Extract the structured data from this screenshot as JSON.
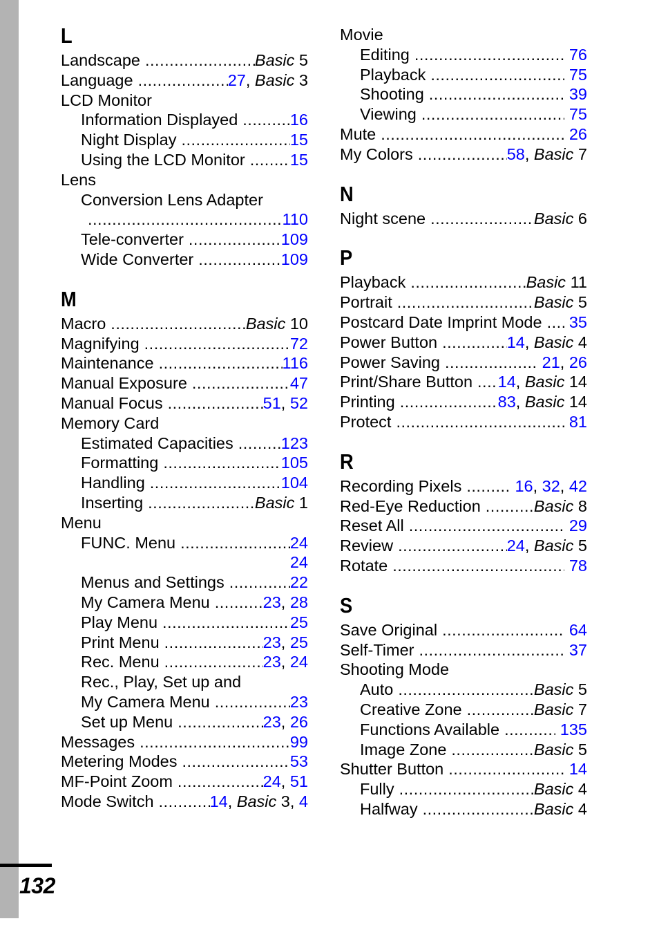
{
  "page": {
    "number": "132",
    "accent_blue": "#0000ff",
    "spine_gray": "#b3b3b3"
  },
  "columns": {
    "left": [
      {
        "letter": "L",
        "entries": [
          {
            "kind": "entry",
            "label": "Landscape",
            "pages": "Basic 5",
            "basic": true
          },
          {
            "kind": "entry",
            "label": "Language",
            "pages": "27, Basic 3",
            "basic": true
          },
          {
            "kind": "label",
            "label": "LCD Monitor"
          },
          {
            "kind": "entry",
            "sub": true,
            "label": "Information Displayed",
            "pages": "16"
          },
          {
            "kind": "entry",
            "sub": true,
            "label": "Night Display",
            "pages": "15"
          },
          {
            "kind": "entry",
            "sub": true,
            "label": "Using the LCD Monitor",
            "pages": "15"
          },
          {
            "kind": "label",
            "label": "Lens"
          },
          {
            "kind": "label",
            "sub": true,
            "label": "Conversion Lens Adapter"
          },
          {
            "kind": "cont",
            "sub": true,
            "pages": "110"
          },
          {
            "kind": "entry",
            "sub": true,
            "label": "Tele-converter",
            "pages": "109"
          },
          {
            "kind": "entry",
            "sub": true,
            "label": "Wide Converter",
            "pages": "109"
          }
        ]
      },
      {
        "letter": "M",
        "entries": [
          {
            "kind": "entry",
            "label": "Macro",
            "pages": "Basic 10",
            "basic": true
          },
          {
            "kind": "entry",
            "label": "Magnifying",
            "pages": "72"
          },
          {
            "kind": "entry",
            "label": "Maintenance",
            "pages": "116"
          },
          {
            "kind": "entry",
            "label": "Manual Exposure",
            "pages": "47"
          },
          {
            "kind": "entry",
            "label": "Manual Focus",
            "pages": "51, 52"
          },
          {
            "kind": "label",
            "label": "Memory Card"
          },
          {
            "kind": "entry",
            "sub": true,
            "label": "Estimated Capacities",
            "pages": "123"
          },
          {
            "kind": "entry",
            "sub": true,
            "label": "Formatting",
            "pages": "105"
          },
          {
            "kind": "entry",
            "sub": true,
            "label": "Handling",
            "pages": "104"
          },
          {
            "kind": "entry",
            "sub": true,
            "label": "Inserting",
            "pages": "Basic 1",
            "basic": true
          },
          {
            "kind": "label",
            "label": "Menu"
          },
          {
            "kind": "entry",
            "sub": true,
            "label": "FUNC. Menu",
            "pages": "24"
          },
          {
            "kind": "bare",
            "sub": true,
            "pages": "24"
          },
          {
            "kind": "entry",
            "sub": true,
            "label": "Menus and Settings",
            "pages": "22"
          },
          {
            "kind": "entry",
            "sub": true,
            "label": "My Camera Menu",
            "pages": "23, 28"
          },
          {
            "kind": "entry",
            "sub": true,
            "label": "Play Menu",
            "pages": "25"
          },
          {
            "kind": "entry",
            "sub": true,
            "label": "Print Menu",
            "pages": "23, 25"
          },
          {
            "kind": "entry",
            "sub": true,
            "label": "Rec. Menu",
            "pages": "23, 24"
          },
          {
            "kind": "label",
            "sub": true,
            "label": "Rec., Play, Set up and"
          },
          {
            "kind": "entry",
            "sub": true,
            "label": "My Camera Menu",
            "pages": "23"
          },
          {
            "kind": "entry",
            "sub": true,
            "label": "Set up Menu",
            "pages": "23, 26"
          },
          {
            "kind": "entry",
            "label": "Messages",
            "pages": "99"
          },
          {
            "kind": "entry",
            "label": "Metering Modes",
            "pages": "53"
          },
          {
            "kind": "entry",
            "label": "MF-Point Zoom",
            "pages": "24, 51"
          },
          {
            "kind": "entry",
            "label": "Mode Switch",
            "pages": "14, Basic 3, 4",
            "basic": true
          }
        ]
      }
    ],
    "right": [
      {
        "letter": "",
        "entries": [
          {
            "kind": "label",
            "label": "Movie"
          },
          {
            "kind": "entry",
            "sub": true,
            "label": "Editing",
            "pages": "76",
            "spacepg": true
          },
          {
            "kind": "entry",
            "sub": true,
            "label": "Playback",
            "pages": "75",
            "spacepg": true
          },
          {
            "kind": "entry",
            "sub": true,
            "label": "Shooting",
            "pages": "39",
            "spacepg": true
          },
          {
            "kind": "entry",
            "sub": true,
            "label": "Viewing",
            "pages": "75",
            "spacepg": true
          },
          {
            "kind": "entry",
            "label": "Mute",
            "pages": "26",
            "spacepg": true
          },
          {
            "kind": "entry",
            "label": "My Colors",
            "pages": "58, Basic 7",
            "basic": true
          }
        ]
      },
      {
        "letter": "N",
        "entries": [
          {
            "kind": "entry",
            "label": "Night scene",
            "pages": "Basic 6",
            "basic": true
          }
        ]
      },
      {
        "letter": "P",
        "entries": [
          {
            "kind": "entry",
            "label": "Playback",
            "pages": "Basic 11",
            "basic": true
          },
          {
            "kind": "entry",
            "label": "Portrait",
            "pages": "Basic 5",
            "basic": true
          },
          {
            "kind": "entry",
            "label": "Postcard Date Imprint Mode",
            "pages": "35",
            "spacepg": true
          },
          {
            "kind": "entry",
            "label": "Power Button",
            "pages": "14, Basic 4",
            "basic": true
          },
          {
            "kind": "entry",
            "label": "Power Saving",
            "pages": "21, 26",
            "spacepg": true
          },
          {
            "kind": "entry",
            "label": "Print/Share Button",
            "pages": "14, Basic 14",
            "basic": true
          },
          {
            "kind": "entry",
            "label": "Printing",
            "pages": "83, Basic 14",
            "basic": true
          },
          {
            "kind": "entry",
            "label": "Protect",
            "pages": "81",
            "spacepg": true
          }
        ]
      },
      {
        "letter": "R",
        "entries": [
          {
            "kind": "entry",
            "label": "Recording Pixels",
            "pages": "16, 32, 42",
            "spacepg": true
          },
          {
            "kind": "entry",
            "label": "Red-Eye Reduction",
            "pages": "Basic 8",
            "basic": true
          },
          {
            "kind": "entry",
            "label": "Reset All",
            "pages": "29",
            "spacepg": true
          },
          {
            "kind": "entry",
            "label": "Review",
            "pages": "24, Basic 5",
            "basic": true
          },
          {
            "kind": "entry",
            "label": "Rotate",
            "pages": "78",
            "spacepg": true
          }
        ]
      },
      {
        "letter": "S",
        "entries": [
          {
            "kind": "entry",
            "label": "Save Original",
            "pages": "64",
            "spacepg": true
          },
          {
            "kind": "entry",
            "label": "Self-Timer",
            "pages": "37",
            "spacepg": true
          },
          {
            "kind": "label",
            "label": "Shooting Mode"
          },
          {
            "kind": "entry",
            "sub": true,
            "label": "Auto",
            "pages": "Basic 5",
            "basic": true
          },
          {
            "kind": "entry",
            "sub": true,
            "label": "Creative Zone",
            "pages": "Basic 7",
            "basic": true
          },
          {
            "kind": "entry",
            "sub": true,
            "label": "Functions Available",
            "pages": "135",
            "spacepg": true
          },
          {
            "kind": "entry",
            "sub": true,
            "label": "Image Zone",
            "pages": "Basic 5",
            "basic": true
          },
          {
            "kind": "entry",
            "label": "Shutter Button",
            "pages": "14",
            "spacepg": true
          },
          {
            "kind": "entry",
            "sub": true,
            "label": "Fully",
            "pages": "Basic 4",
            "basic": true
          },
          {
            "kind": "entry",
            "sub": true,
            "label": "Halfway",
            "pages": "Basic 4",
            "basic": true
          }
        ]
      }
    ]
  }
}
